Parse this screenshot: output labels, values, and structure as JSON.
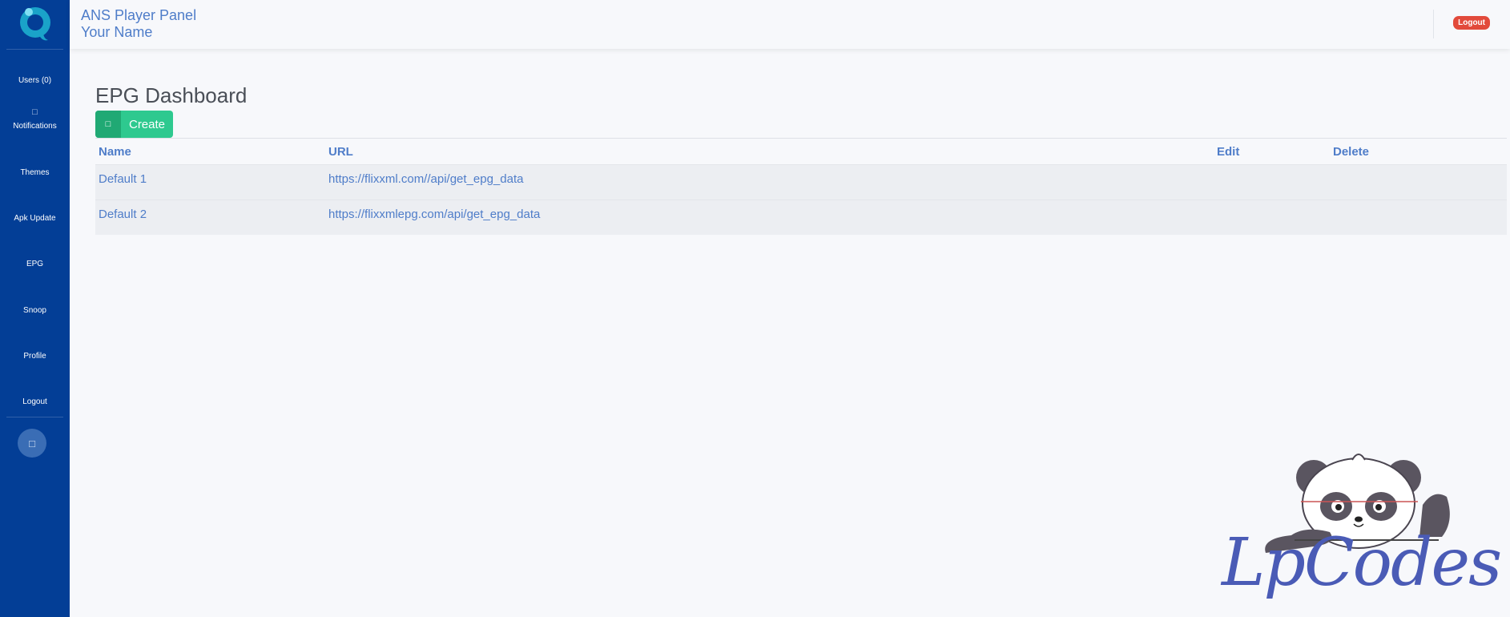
{
  "sidebar": {
    "logo": "app-logo",
    "items": [
      {
        "label": "Users (0)",
        "icon": ""
      },
      {
        "label": "Notifications",
        "icon": "bell-icon"
      },
      {
        "label": "Themes",
        "icon": ""
      },
      {
        "label": "Apk Update",
        "icon": ""
      },
      {
        "label": "EPG",
        "icon": ""
      },
      {
        "label": "Snoop",
        "icon": ""
      },
      {
        "label": "Profile",
        "icon": ""
      },
      {
        "label": "Logout",
        "icon": ""
      }
    ],
    "bottom_button_icon": "toggle-icon"
  },
  "header": {
    "title": "ANS Player Panel",
    "subtitle": "Your Name",
    "logout_label": "Logout"
  },
  "main": {
    "page_title": "EPG Dashboard",
    "create_label": "Create",
    "table": {
      "columns": [
        "Name",
        "URL",
        "Edit",
        "Delete"
      ],
      "rows": [
        {
          "name": "Default 1",
          "url": "https://flixxml.com//api/get_epg_data"
        },
        {
          "name": "Default 2",
          "url": "https://flixxmlepg.com/api/get_epg_data"
        }
      ]
    }
  },
  "watermark": {
    "text": "LpCodes"
  },
  "colors": {
    "sidebar": "#033e96",
    "link": "#4f7dc9",
    "create": "#2ec98f",
    "logout": "#e24a3b"
  }
}
